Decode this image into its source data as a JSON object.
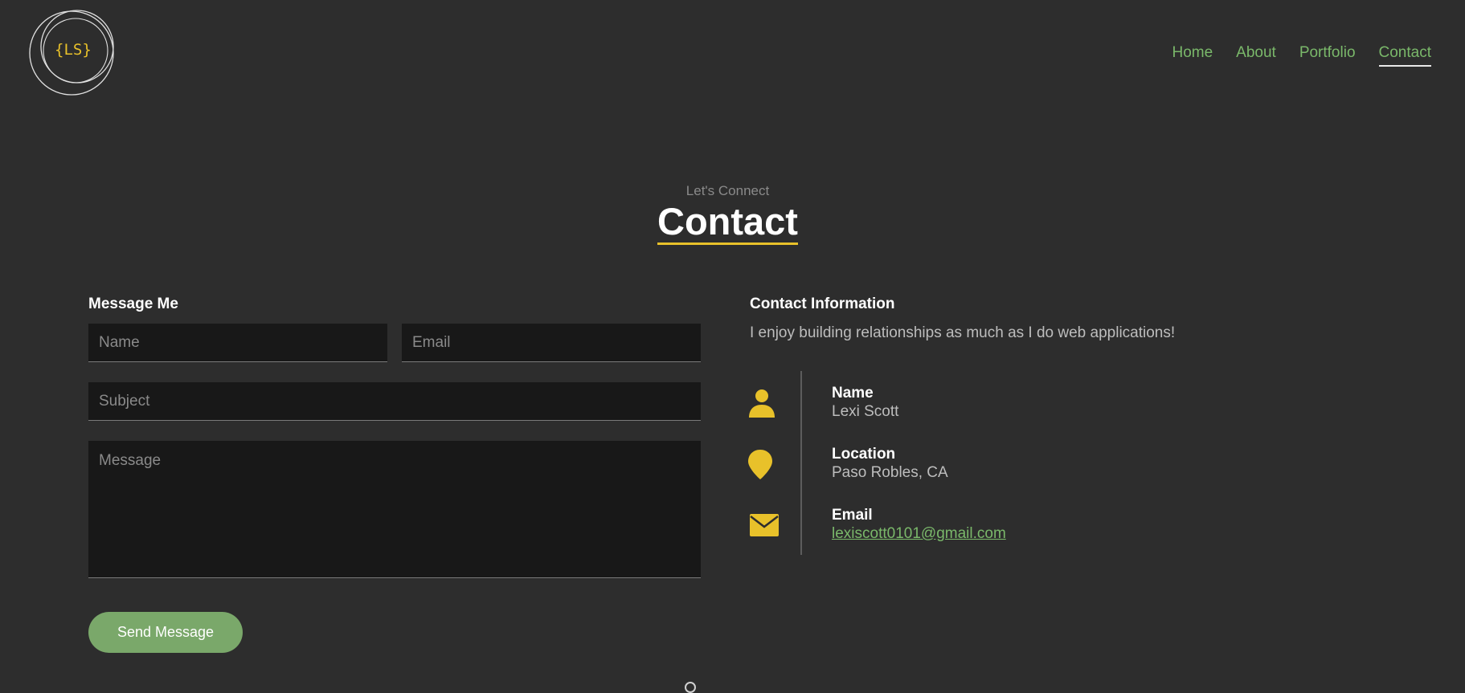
{
  "logo": {
    "text": "{LS}"
  },
  "nav": {
    "items": [
      {
        "label": "Home",
        "active": false
      },
      {
        "label": "About",
        "active": false
      },
      {
        "label": "Portfolio",
        "active": false
      },
      {
        "label": "Contact",
        "active": true
      }
    ]
  },
  "header": {
    "subtitle": "Let's Connect",
    "title": "Contact"
  },
  "form": {
    "heading": "Message Me",
    "name_placeholder": "Name",
    "email_placeholder": "Email",
    "subject_placeholder": "Subject",
    "message_placeholder": "Message",
    "send_label": "Send Message"
  },
  "info": {
    "heading": "Contact Information",
    "text": "I enjoy building relationships as much as I do web applications!",
    "items": [
      {
        "icon": "person-icon",
        "label": "Name",
        "value": "Lexi Scott"
      },
      {
        "icon": "map-pin-icon",
        "label": "Location",
        "value": "Paso Robles, CA"
      },
      {
        "icon": "envelope-icon",
        "label": "Email",
        "value": "lexiscott0101@gmail.com"
      }
    ]
  },
  "colors": {
    "background": "#2d2d2d",
    "accent_yellow": "#e8c12a",
    "accent_green": "#7ab86a",
    "field_bg": "#181818"
  }
}
